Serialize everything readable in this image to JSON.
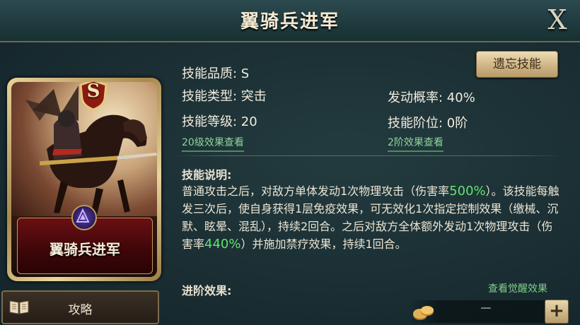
{
  "header": {
    "title": "翼骑兵进军",
    "close_label": "X"
  },
  "card": {
    "rank": "S",
    "name": "翼骑兵进军"
  },
  "guide_button": {
    "label": "攻略"
  },
  "forget_button": {
    "label": "遗忘技能"
  },
  "info": {
    "quality": "技能品质: S",
    "type": "技能类型: 突击",
    "level": "技能等级: 20",
    "trigger_rate": "发动概率: 40%",
    "stage": "技能阶位: 0阶",
    "level_link": "20级效果查看",
    "stage_link": "2阶效果查看"
  },
  "description": {
    "title": "技能说明:",
    "part1": "普通攻击之后，对敌方单体发动1次物理攻击（伤害率",
    "value1": "500%",
    "part2": "）。该技能每触发三次后，使自身获得1层免疫效果，可无效化1次指定控制效果（缴械、沉默、眩晕、混乱），持续2回合。之后对敌方全体额外发动1次物理攻击（伤害率",
    "value2": "440%",
    "part3": "）并施加禁疗效果，持续1回合。"
  },
  "advance": {
    "title": "进阶效果:",
    "awaken_link": "查看觉醒效果"
  },
  "bottom": {
    "minus_label": "−",
    "plus_label": "+"
  }
}
